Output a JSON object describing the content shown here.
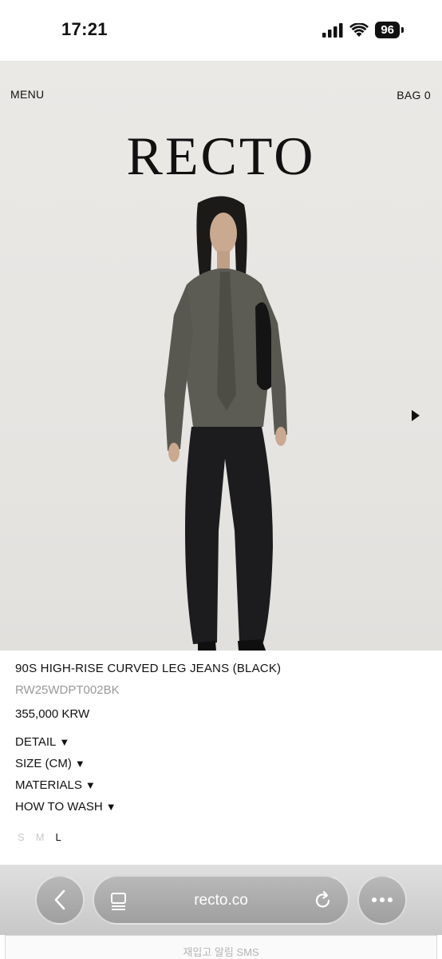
{
  "status_bar": {
    "time": "17:21",
    "battery": "96"
  },
  "header": {
    "menu_label": "MENU",
    "logo": "RECTO",
    "bag_label": "BAG 0"
  },
  "product": {
    "title": "90S HIGH-RISE CURVED LEG JEANS (BLACK)",
    "code": "RW25WDPT002BK",
    "price": "355,000 KRW",
    "sections": [
      {
        "label": "DETAIL",
        "arrow": "▼"
      },
      {
        "label": "SIZE (CM)",
        "arrow": "▼"
      },
      {
        "label": "MATERIALS",
        "arrow": "▼"
      },
      {
        "label": "HOW TO WASH",
        "arrow": "▼"
      }
    ],
    "sizes": [
      {
        "label": "S",
        "available": false
      },
      {
        "label": "M",
        "available": false
      },
      {
        "label": "L",
        "available": true
      }
    ]
  },
  "browser": {
    "url": "recto.co"
  },
  "sms_button": {
    "label": "재입고 알림 SMS"
  }
}
